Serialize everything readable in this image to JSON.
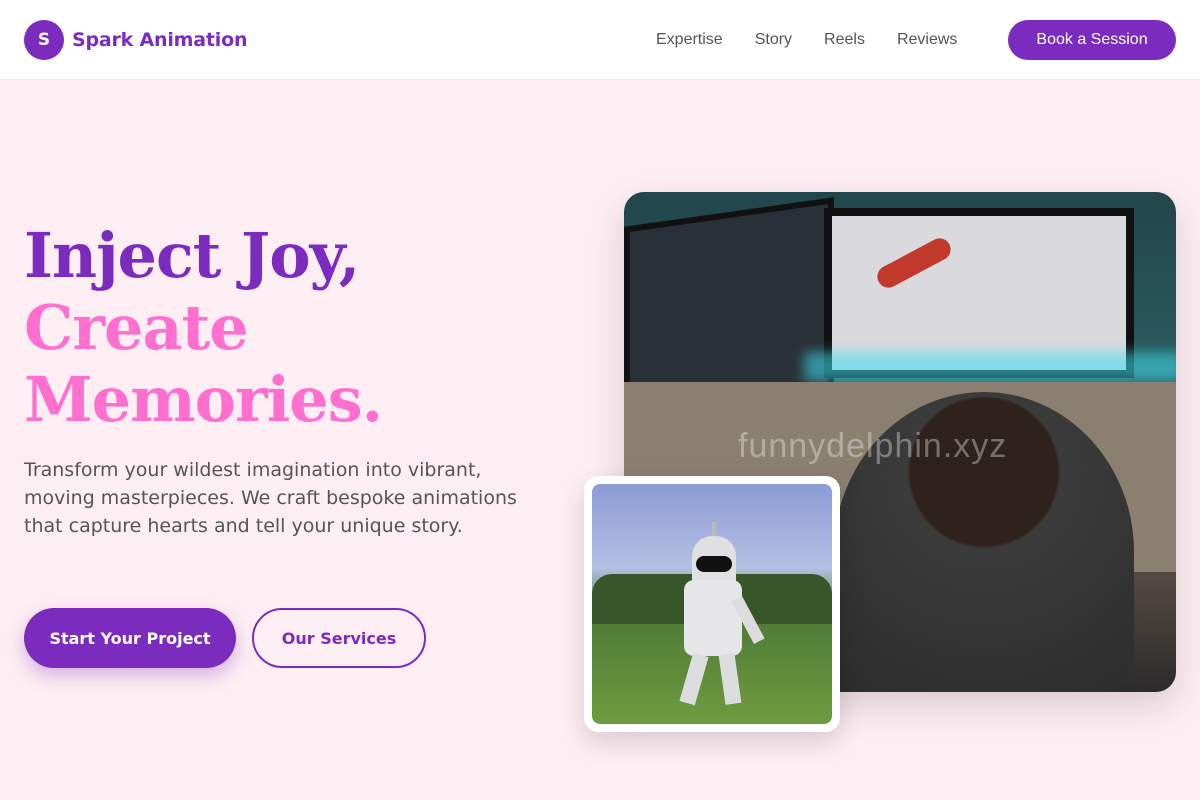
{
  "brand": {
    "initial": "S",
    "name": "Spark Animation"
  },
  "nav": {
    "items": [
      {
        "label": "Expertise"
      },
      {
        "label": "Story"
      },
      {
        "label": "Reels"
      },
      {
        "label": "Reviews"
      }
    ],
    "cta": "Book a Session"
  },
  "hero": {
    "title_line1": "Inject Joy,",
    "title_line2": "Create",
    "title_line3": "Memories.",
    "subtitle": "Transform your wildest imagination into vibrant, moving masterpieces. We craft bespoke animations that capture hearts and tell your unique story.",
    "primary_cta": "Start Your Project",
    "secondary_cta": "Our Services"
  },
  "media": {
    "watermark": "funnydelphin.xyz"
  },
  "colors": {
    "brand_purple": "#7b2cbf",
    "accent_pink": "#ff6fcf",
    "background": "#fdeef3"
  },
  "icons": {
    "logo": "spark-logo-mark"
  }
}
